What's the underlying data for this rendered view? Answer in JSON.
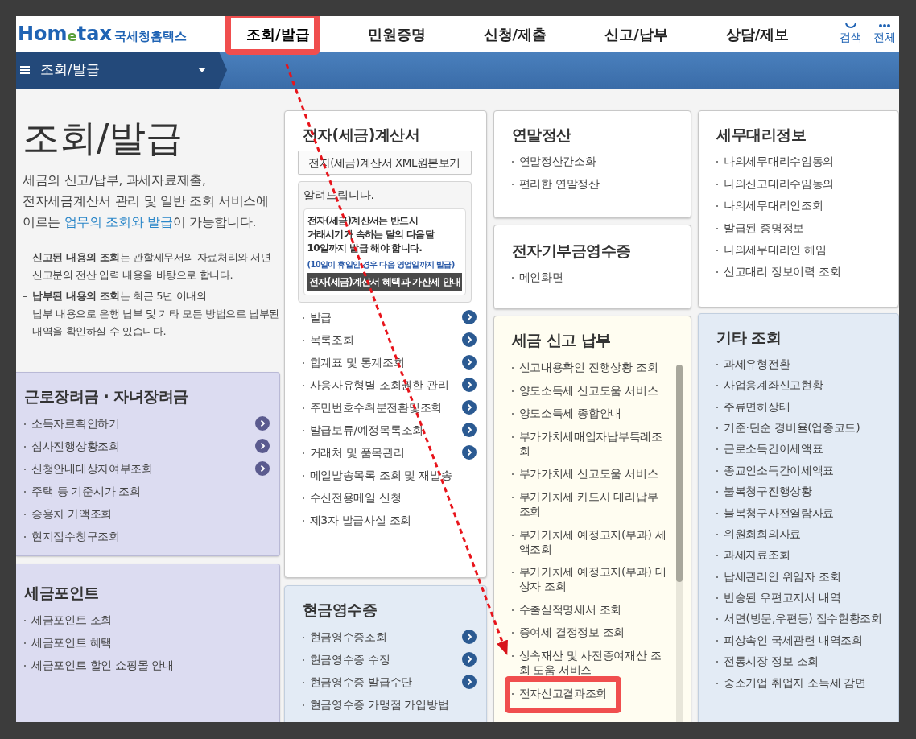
{
  "header": {
    "logo": {
      "wordmark": "Hom$_{e}$tax",
      "name": "국세청홈택스"
    },
    "nav": [
      {
        "label": "조회/발급",
        "selected": true,
        "highlighted": true
      },
      {
        "label": "민원증명",
        "selected": false,
        "highlighted": false
      },
      {
        "label": "신청/제출",
        "selected": false,
        "highlighted": false
      },
      {
        "label": "신고/납부",
        "selected": false,
        "highlighted": false
      },
      {
        "label": "상담/제보",
        "selected": false,
        "highlighted": false
      }
    ],
    "tools": [
      {
        "kind": "search",
        "label": "검색"
      },
      {
        "kind": "menu",
        "label": "전체"
      }
    ]
  },
  "section_bar": {
    "title": "조회/발급"
  },
  "intro": {
    "title": "조회/발급",
    "description": [
      {
        "kind": "plain",
        "text": "세금의 신고/납부, 과세자료제출,\n전자세금계산서 관리 및 일반 조회 서비스에\n이르는 "
      },
      {
        "kind": "highlight",
        "text": "업무의 조회와 발급"
      },
      {
        "kind": "plain",
        "text": "이 가능합니다."
      }
    ],
    "notes": [
      "**신고된 내용의 조회**는 관할세무서의 자료처리와 서면신고분의 전산 입력 내용을 바탕으로 합니다.",
      "**납부된 내용의 조회**는 최근 5년 이내의\n납부 내용으로 은행 납부 및 기타 모든 방법으로 납부된 내역을 확인하실 수 있습니다."
    ]
  },
  "columns": [
    [
      {
        "title": "근로장려금 · 자녀장려금",
        "kind": "purple",
        "items": [
          {
            "label": "소득자료확인하기",
            "arrow": true
          },
          {
            "label": "심사진행상황조회",
            "arrow": true
          },
          {
            "label": "신청안내대상자여부조회",
            "arrow": true
          },
          {
            "label": "주택 등 기준시가 조회",
            "arrow": false
          },
          {
            "label": "승용차 가액조회",
            "arrow": false
          },
          {
            "label": "현지접수창구조회",
            "arrow": false
          }
        ]
      },
      {
        "title": "세금포인트",
        "kind": "purple",
        "items": [
          {
            "label": "세금포인트 조회",
            "arrow": false
          },
          {
            "label": "세금포인트 혜택",
            "arrow": false
          },
          {
            "label": "세금포인트 할인 쇼핑몰 안내",
            "arrow": false
          }
        ]
      }
    ],
    [
      {
        "title": "전자(세금)계산서",
        "kind": "white",
        "button": "전자(세금)계산서 XML원본보기",
        "notice": {
          "title": "알려드립니다.",
          "message": "**전자(세금)계산서**는 반드시\n거래시기가 **속하는 달의 다음달**\n**10일까지 발급** 해야 합니다.",
          "remark": "(10일이 휴일인 경우 다음 영업일까지 발급)",
          "button": "전자(세금)계산서 혜택과 가산세 안내"
        },
        "items": [
          {
            "label": "발급",
            "arrow": true
          },
          {
            "label": "목록조회",
            "arrow": true
          },
          {
            "label": "합계표 및 통계조회",
            "arrow": true
          },
          {
            "label": "사용자유형별 조회권한 관리",
            "arrow": true
          },
          {
            "label": "주민번호수취분전환및조회",
            "arrow": true
          },
          {
            "label": "발급보류/예정목록조회",
            "arrow": true
          },
          {
            "label": "거래처 및 품목관리",
            "arrow": true
          },
          {
            "label": "메일발송목록 조회 및 재발송",
            "arrow": false
          },
          {
            "label": "수신전용메일 신청",
            "arrow": false
          },
          {
            "label": "제3자 발급사실 조회",
            "arrow": false
          }
        ]
      },
      {
        "title": "현금영수증",
        "kind": "blue",
        "items": [
          {
            "label": "현금영수증조회",
            "arrow": true
          },
          {
            "label": "현금영수증 수정",
            "arrow": true
          },
          {
            "label": "현금영수증 발급수단",
            "arrow": true
          },
          {
            "label": "현금영수증 가맹점 가입방법",
            "arrow": false
          }
        ]
      }
    ],
    [
      {
        "title": "연말정산",
        "kind": "white",
        "items": [
          {
            "label": "연말정산간소화",
            "arrow": false
          },
          {
            "label": "편리한 연말정산",
            "arrow": false
          }
        ]
      },
      {
        "title": "전자기부금영수증",
        "kind": "white",
        "items": [
          {
            "label": "메인화면",
            "arrow": false
          }
        ]
      },
      {
        "title": "세금 신고 납부",
        "kind": "yellow",
        "scrollbar": true,
        "items": [
          {
            "label": "신고내용확인 진행상황 조회",
            "arrow": false,
            "highlighted": false
          },
          {
            "label": "양도소득세 신고도움 서비스",
            "arrow": false,
            "highlighted": false
          },
          {
            "label": "양도소득세 종합안내",
            "arrow": false,
            "highlighted": false
          },
          {
            "label": "부가가치세매입자납부특례조회",
            "arrow": false,
            "highlighted": false
          },
          {
            "label": "부가가치세 신고도움 서비스",
            "arrow": false,
            "highlighted": false
          },
          {
            "label": "부가가치세 카드사 대리납부 조회",
            "arrow": false,
            "highlighted": false
          },
          {
            "label": "부가가치세 예정고지(부과) 세액조회",
            "arrow": false,
            "highlighted": false
          },
          {
            "label": "부가가치세 예정고지(부과) 대상자 조회",
            "arrow": false,
            "highlighted": false
          },
          {
            "label": "수출실적명세서 조회",
            "arrow": false,
            "highlighted": false
          },
          {
            "label": "증여세 결정정보 조회",
            "arrow": false,
            "highlighted": false
          },
          {
            "label": "상속재산 및 사전증여재산 조회 도움 서비스",
            "arrow": false,
            "highlighted": false
          },
          {
            "label": "전자신고결과조회",
            "arrow": false,
            "highlighted": true
          }
        ]
      }
    ],
    [
      {
        "title": "세무대리정보",
        "kind": "white",
        "items": [
          {
            "label": "나의세무대리수임동의",
            "arrow": false
          },
          {
            "label": "나의신고대리수임동의",
            "arrow": false
          },
          {
            "label": "나의세무대리인조회",
            "arrow": false
          },
          {
            "label": "발급된 증명정보",
            "arrow": false
          },
          {
            "label": "나의세무대리인 해임",
            "arrow": false
          },
          {
            "label": "신고대리 정보이력 조회",
            "arrow": false
          }
        ]
      },
      {
        "title": "기타 조회",
        "kind": "blue",
        "items": [
          {
            "label": "과세유형전환",
            "arrow": false
          },
          {
            "label": "사업용계좌신고현황",
            "arrow": false
          },
          {
            "label": "주류면허상태",
            "arrow": false
          },
          {
            "label": "기준·단순 경비율(업종코드)",
            "arrow": false
          },
          {
            "label": "근로소득간이세액표",
            "arrow": false
          },
          {
            "label": "종교인소득간이세액표",
            "arrow": false
          },
          {
            "label": "불복청구진행상황",
            "arrow": false
          },
          {
            "label": "불복청구사전열람자료",
            "arrow": false
          },
          {
            "label": "위원회회의자료",
            "arrow": false
          },
          {
            "label": "과세자료조회",
            "arrow": false
          },
          {
            "label": "납세관리인 위임자 조회",
            "arrow": false
          },
          {
            "label": "반송된 우편고지서 내역",
            "arrow": false
          },
          {
            "label": "서면(방문,우편등) 접수현황조회",
            "arrow": false
          },
          {
            "label": "피상속인 국세관련 내역조회",
            "arrow": false
          },
          {
            "label": "전통시장 정보 조회",
            "arrow": false
          },
          {
            "label": "중소기업 취업자 소득세 감면",
            "arrow": false
          }
        ]
      }
    ]
  ]
}
